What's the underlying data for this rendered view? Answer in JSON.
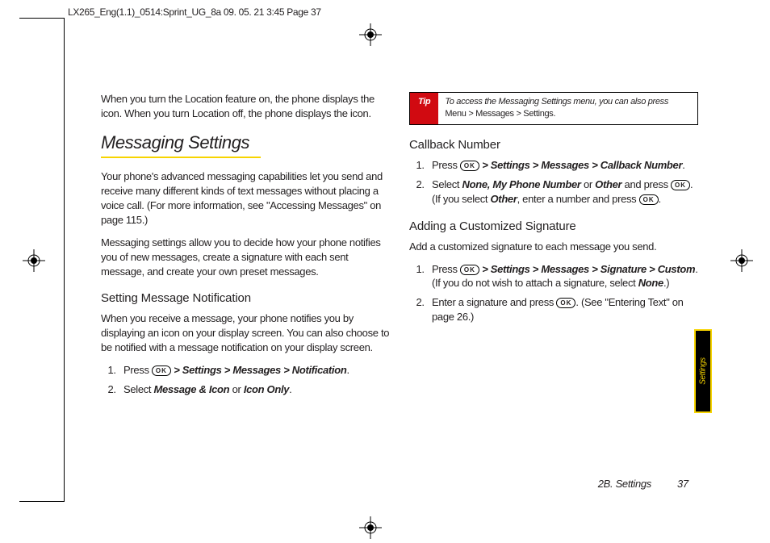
{
  "slug": "LX265_Eng(1.1)_0514:Sprint_UG_8a  09. 05. 21    3:45  Page 37",
  "tab_label": "Settings",
  "footer": {
    "section": "2B. Settings",
    "page": "37"
  },
  "col1": {
    "intro": "When you turn the Location feature on, the phone displays the      icon. When you turn Location off, the phone displays the      icon.",
    "h1": "Messaging Settings",
    "p1": "Your phone's advanced messaging capabilities let you send and receive many different kinds of text messages without placing a voice call. (For more information, see \"Accessing Messages\" on page 115.)",
    "p2": "Messaging settings allow you to decide how your phone notifies you of new messages, create a signature with each sent message, and create your own preset messages.",
    "h2": "Setting Message Notification",
    "p3": "When you receive a message, your phone notifies you by displaying an icon on your display screen. You can also choose to be notified with a message notification on your display screen.",
    "s1_pre": "Press ",
    "s1_path": " > Settings > Messages > Notification",
    "s2_pre": "Select ",
    "s2_a": "Message & Icon",
    "s2_mid": " or ",
    "s2_b": "Icon Only",
    "ok": "OK"
  },
  "col2": {
    "tip_label": "Tip",
    "tip_body_a": "To access the Messaging Settings menu, you can also press ",
    "tip_body_b": "Menu > Messages > Settings.",
    "h2a": "Callback Number",
    "cb1_pre": "Press ",
    "cb1_path": " > Settings > Messages > Callback Number",
    "cb2_pre": "Select ",
    "cb2_a": "None, My Phone Number",
    "cb2_mid": " or ",
    "cb2_b": "Other",
    "cb2_post1": " and press ",
    "cb2_post2": ". (If you select ",
    "cb2_c": "Other",
    "cb2_post3": ", enter a number and press ",
    "cb2_post4": ".",
    "h2b": "Adding a Customized Signature",
    "sig_p": "Add a customized signature to each message you send.",
    "sig1_pre": "Press ",
    "sig1_path": " > Settings > Messages > Signature > Custom",
    "sig1_post1": ". (If you do not wish to attach a signature, select ",
    "sig1_b": "None",
    "sig1_post2": ".)",
    "sig2_pre": "Enter a signature and press ",
    "sig2_post": ". (See \"Entering Text\" on page 26.)"
  }
}
